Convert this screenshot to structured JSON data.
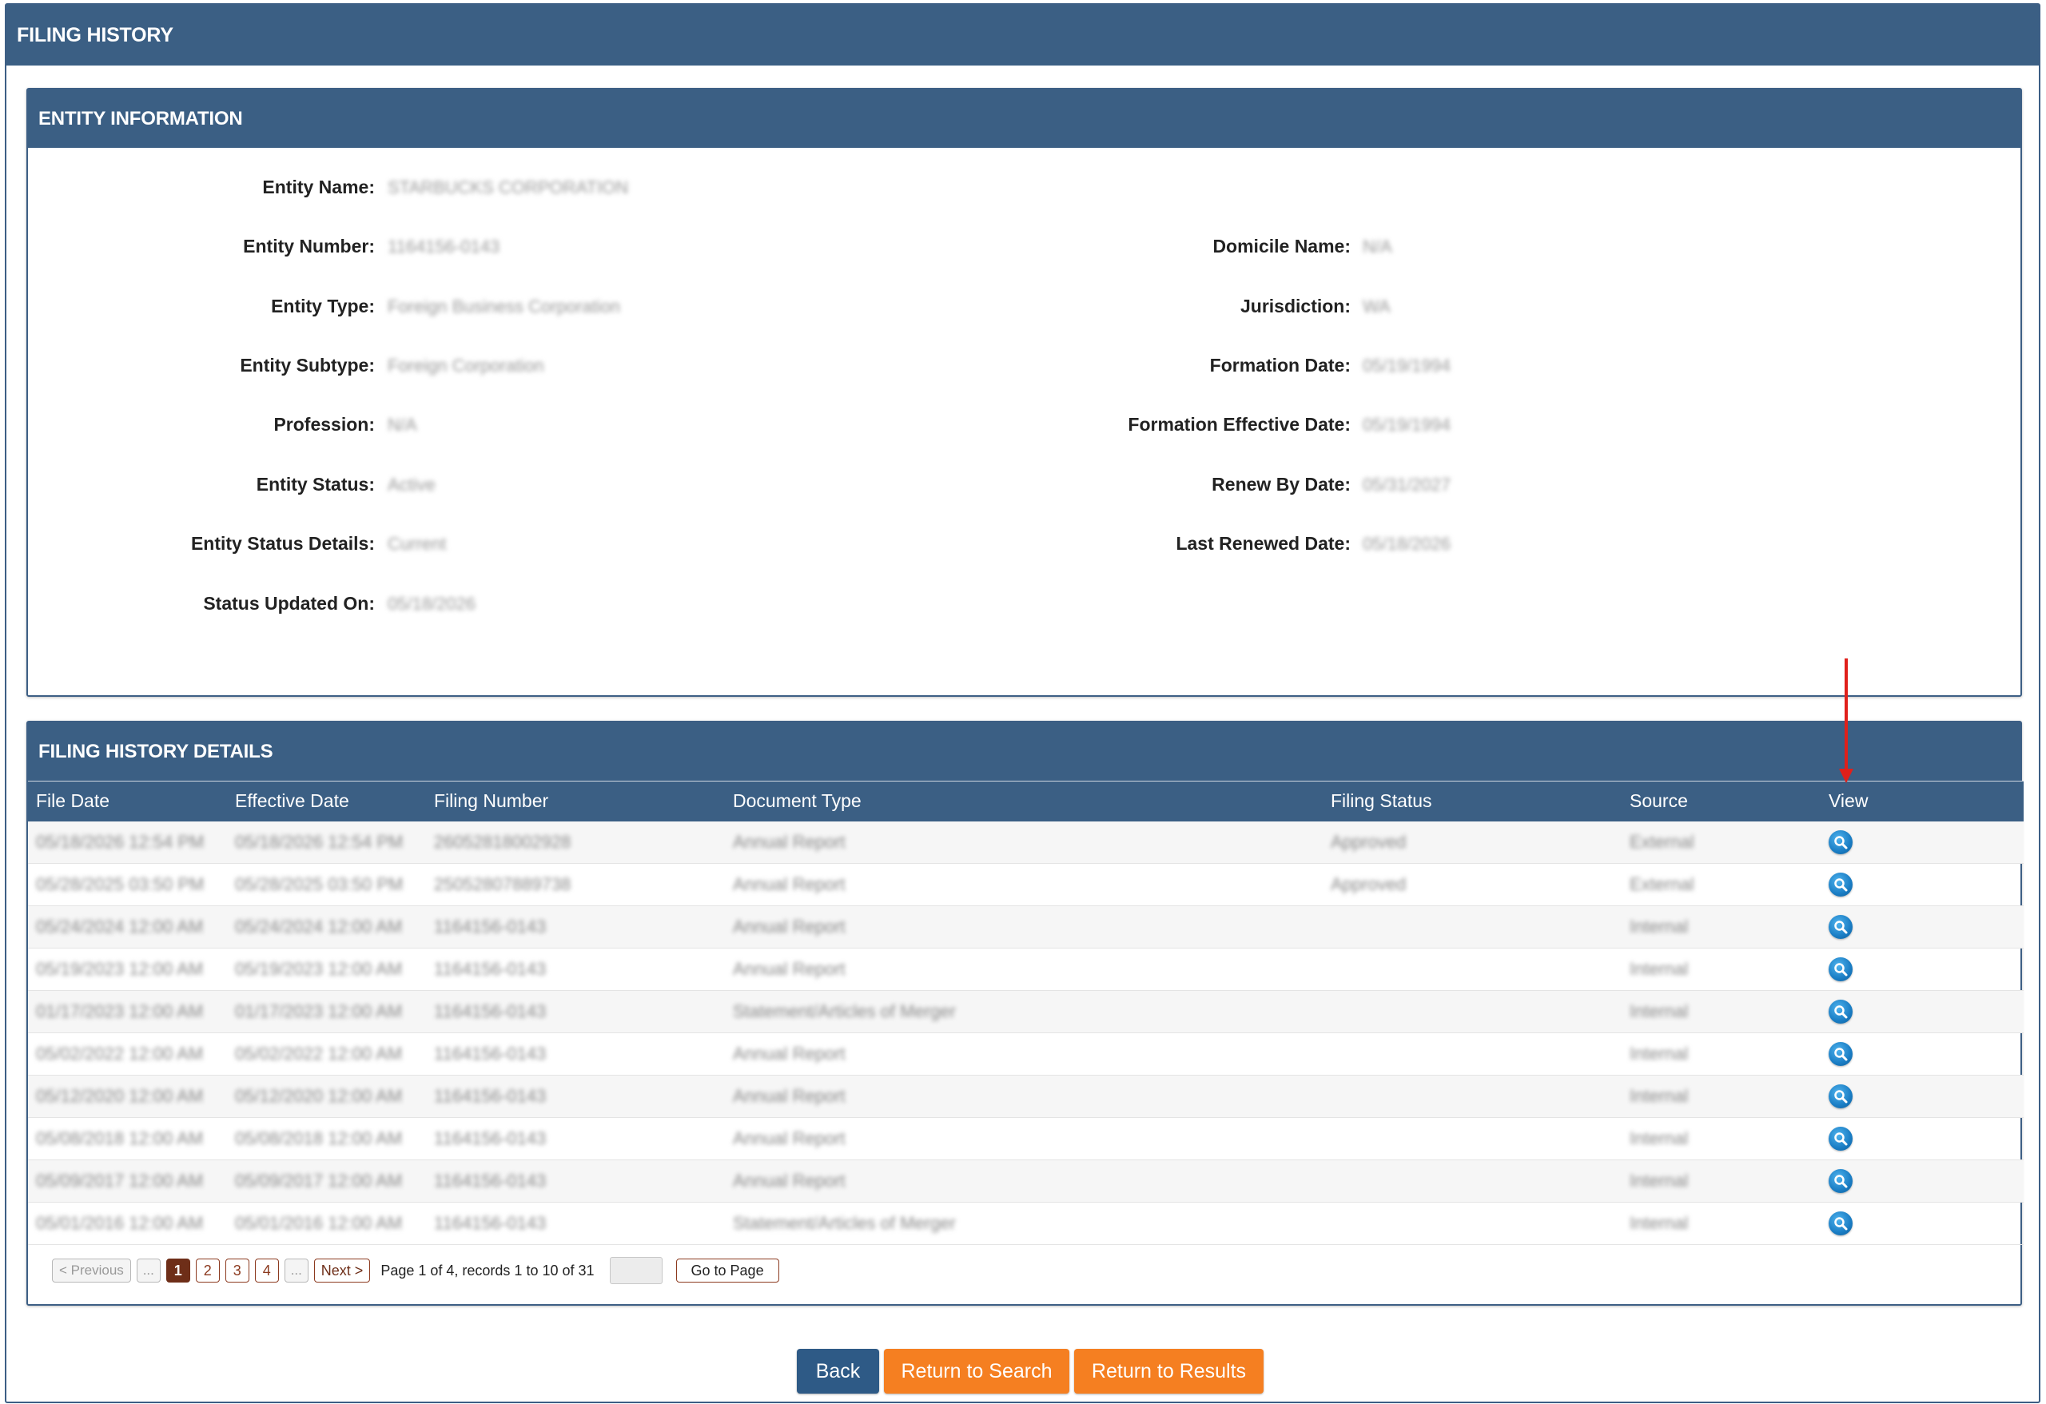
{
  "page": {
    "title": "FILING HISTORY"
  },
  "entity_info": {
    "title": "ENTITY INFORMATION",
    "left": [
      {
        "label": "Entity Name:",
        "value": "STARBUCKS CORPORATION"
      },
      {
        "label": "Entity Number:",
        "value": "1164156-0143"
      },
      {
        "label": "Entity Type:",
        "value": "Foreign Business Corporation"
      },
      {
        "label": "Entity Subtype:",
        "value": "Foreign Corporation"
      },
      {
        "label": "Profession:",
        "value": "N/A"
      },
      {
        "label": "Entity Status:",
        "value": "Active"
      },
      {
        "label": "Entity Status Details:",
        "value": "Current"
      },
      {
        "label": "Status Updated On:",
        "value": "05/18/2026"
      }
    ],
    "right": [
      {
        "label": "Domicile Name:",
        "value": "N/A"
      },
      {
        "label": "Jurisdiction:",
        "value": "WA"
      },
      {
        "label": "Formation Date:",
        "value": "05/19/1994"
      },
      {
        "label": "Formation Effective Date:",
        "value": "05/19/1994"
      },
      {
        "label": "Renew By Date:",
        "value": "05/31/2027"
      },
      {
        "label": "Last Renewed Date:",
        "value": "05/18/2026"
      }
    ]
  },
  "filing_history": {
    "title": "FILING HISTORY DETAILS",
    "columns": [
      "File Date",
      "Effective Date",
      "Filing Number",
      "Document Type",
      "Filing Status",
      "Source",
      "View"
    ],
    "rows": [
      [
        "05/18/2026 12:54 PM",
        "05/18/2026 12:54 PM",
        "26052818002928",
        "Annual Report",
        "Approved",
        "External"
      ],
      [
        "05/28/2025 03:50 PM",
        "05/28/2025 03:50 PM",
        "25052807889738",
        "Annual Report",
        "Approved",
        "External"
      ],
      [
        "05/24/2024 12:00 AM",
        "05/24/2024 12:00 AM",
        "1164156-0143",
        "Annual Report",
        "",
        "Internal"
      ],
      [
        "05/19/2023 12:00 AM",
        "05/19/2023 12:00 AM",
        "1164156-0143",
        "Annual Report",
        "",
        "Internal"
      ],
      [
        "01/17/2023 12:00 AM",
        "01/17/2023 12:00 AM",
        "1164156-0143",
        "Statement/Articles of Merger",
        "",
        "Internal"
      ],
      [
        "05/02/2022 12:00 AM",
        "05/02/2022 12:00 AM",
        "1164156-0143",
        "Annual Report",
        "",
        "Internal"
      ],
      [
        "05/12/2020 12:00 AM",
        "05/12/2020 12:00 AM",
        "1164156-0143",
        "Annual Report",
        "",
        "Internal"
      ],
      [
        "05/08/2018 12:00 AM",
        "05/08/2018 12:00 AM",
        "1164156-0143",
        "Annual Report",
        "",
        "Internal"
      ],
      [
        "05/09/2017 12:00 AM",
        "05/09/2017 12:00 AM",
        "1164156-0143",
        "Annual Report",
        "",
        "Internal"
      ],
      [
        "05/01/2016 12:00 AM",
        "05/01/2016 12:00 AM",
        "1164156-0143",
        "Statement/Articles of Merger",
        "",
        "Internal"
      ]
    ]
  },
  "pager": {
    "prev": "< Previous",
    "ellipsis": "...",
    "pages": [
      "1",
      "2",
      "3",
      "4"
    ],
    "next": "Next >",
    "info": "Page 1 of 4, records 1 to 10 of 31",
    "go": "Go to Page"
  },
  "actions": {
    "back": "Back",
    "return_search": "Return to Search",
    "return_results": "Return to Results"
  },
  "colors": {
    "header_blue": "#3b5f84",
    "orange": "#f57f21",
    "pager_brown": "#6e2e18",
    "annotation_red": "#e0201b"
  }
}
